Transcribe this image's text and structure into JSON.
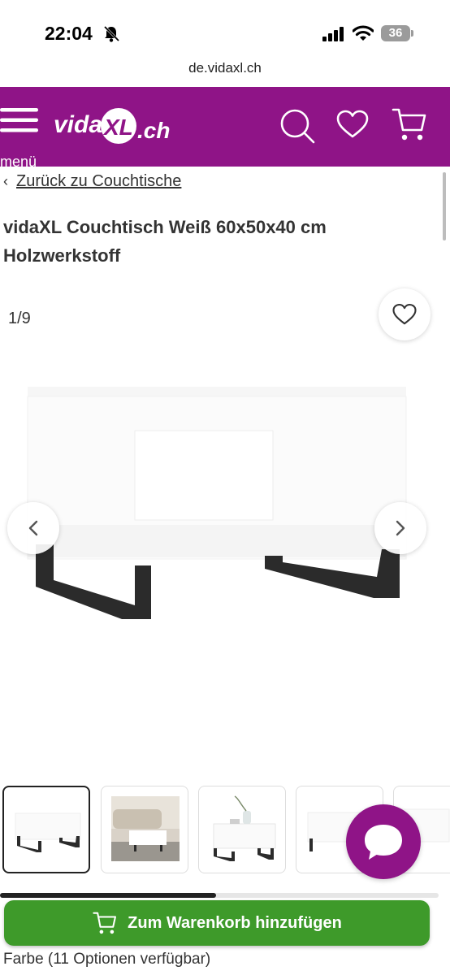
{
  "status_bar": {
    "time": "22:04",
    "battery": "36"
  },
  "browser": {
    "url": "de.vidaxl.ch"
  },
  "header": {
    "menu_label": "menü",
    "logo_text_left": "vida",
    "logo_text_mark": "XL",
    "logo_text_right": ".ch",
    "brand_color": "#8f1487"
  },
  "breadcrumb": {
    "chevron": "‹",
    "label": "Zurück zu Couchtische"
  },
  "product": {
    "title": "vidaXL Couchtisch Weiß 60x50x40 cm Holzwerkstoff"
  },
  "gallery": {
    "counter": "1/9",
    "thumbnail_count": 5,
    "thumbnail_scroll_fraction": 0.49
  },
  "actions": {
    "add_to_cart_label": "Zum Warenkorb hinzufügen",
    "cart_button_color": "#3e9a2a"
  },
  "variants": {
    "color_options_label": "Farbe (11 Optionen verfügbar)"
  },
  "icons": {
    "status": [
      "bell-slash-icon",
      "signal-icon",
      "wifi-icon",
      "battery-icon"
    ],
    "header": [
      "hamburger-icon",
      "search-icon",
      "heart-icon",
      "cart-icon"
    ],
    "gallery": [
      "heart-icon",
      "chevron-left-icon",
      "chevron-right-icon"
    ],
    "chat": "chat-bubble-icon",
    "cart_button": "cart-icon"
  }
}
